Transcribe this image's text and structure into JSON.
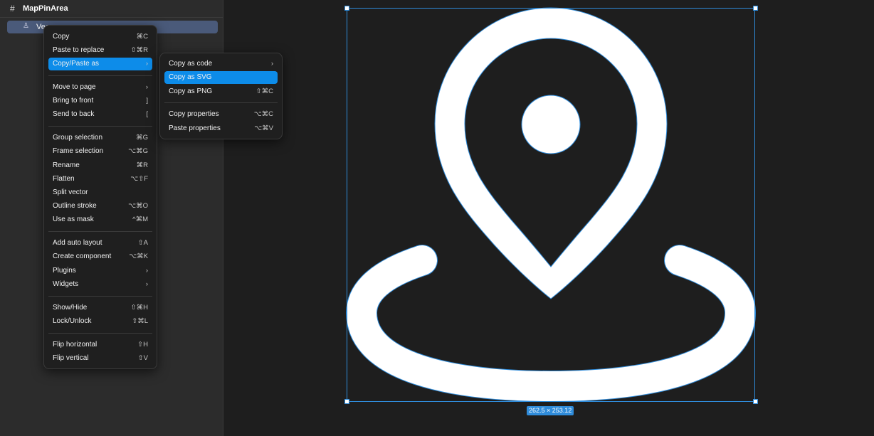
{
  "layers": {
    "frame_name": "MapPinArea",
    "frame_icon": "#",
    "layer_name": "Vec",
    "layer_icon": "♙"
  },
  "canvas": {
    "dimensions": "262.5 × 253.12",
    "selection_color": "#2f8cdb"
  },
  "context_menu": {
    "items": [
      {
        "label": "Copy",
        "shortcut": "⌘C"
      },
      {
        "label": "Paste to replace",
        "shortcut": "⇧⌘R"
      },
      {
        "label": "Copy/Paste as",
        "shortcut": "›"
      },
      {
        "label": "Move to page",
        "shortcut": "›"
      },
      {
        "label": "Bring to front",
        "shortcut": "]"
      },
      {
        "label": "Send to back",
        "shortcut": "["
      },
      {
        "label": "Group selection",
        "shortcut": "⌘G"
      },
      {
        "label": "Frame selection",
        "shortcut": "⌥⌘G"
      },
      {
        "label": "Rename",
        "shortcut": "⌘R"
      },
      {
        "label": "Flatten",
        "shortcut": "⌥⇧F"
      },
      {
        "label": "Split vector",
        "shortcut": ""
      },
      {
        "label": "Outline stroke",
        "shortcut": "⌥⌘O"
      },
      {
        "label": "Use as mask",
        "shortcut": "^⌘M"
      },
      {
        "label": "Add auto layout",
        "shortcut": "⇧A"
      },
      {
        "label": "Create component",
        "shortcut": "⌥⌘K"
      },
      {
        "label": "Plugins",
        "shortcut": "›"
      },
      {
        "label": "Widgets",
        "shortcut": "›"
      },
      {
        "label": "Show/Hide",
        "shortcut": "⇧⌘H"
      },
      {
        "label": "Lock/Unlock",
        "shortcut": "⇧⌘L"
      },
      {
        "label": "Flip horizontal",
        "shortcut": "⇧H"
      },
      {
        "label": "Flip vertical",
        "shortcut": "⇧V"
      }
    ]
  },
  "submenu": {
    "items": [
      {
        "label": "Copy as code",
        "shortcut": "›"
      },
      {
        "label": "Copy as SVG",
        "shortcut": ""
      },
      {
        "label": "Copy as PNG",
        "shortcut": "⇧⌘C"
      },
      {
        "label": "Copy properties",
        "shortcut": "⌥⌘C"
      },
      {
        "label": "Paste properties",
        "shortcut": "⌥⌘V"
      }
    ]
  },
  "colors": {
    "highlight": "#0d8ce9",
    "menu_bg": "#1f1f1f"
  }
}
